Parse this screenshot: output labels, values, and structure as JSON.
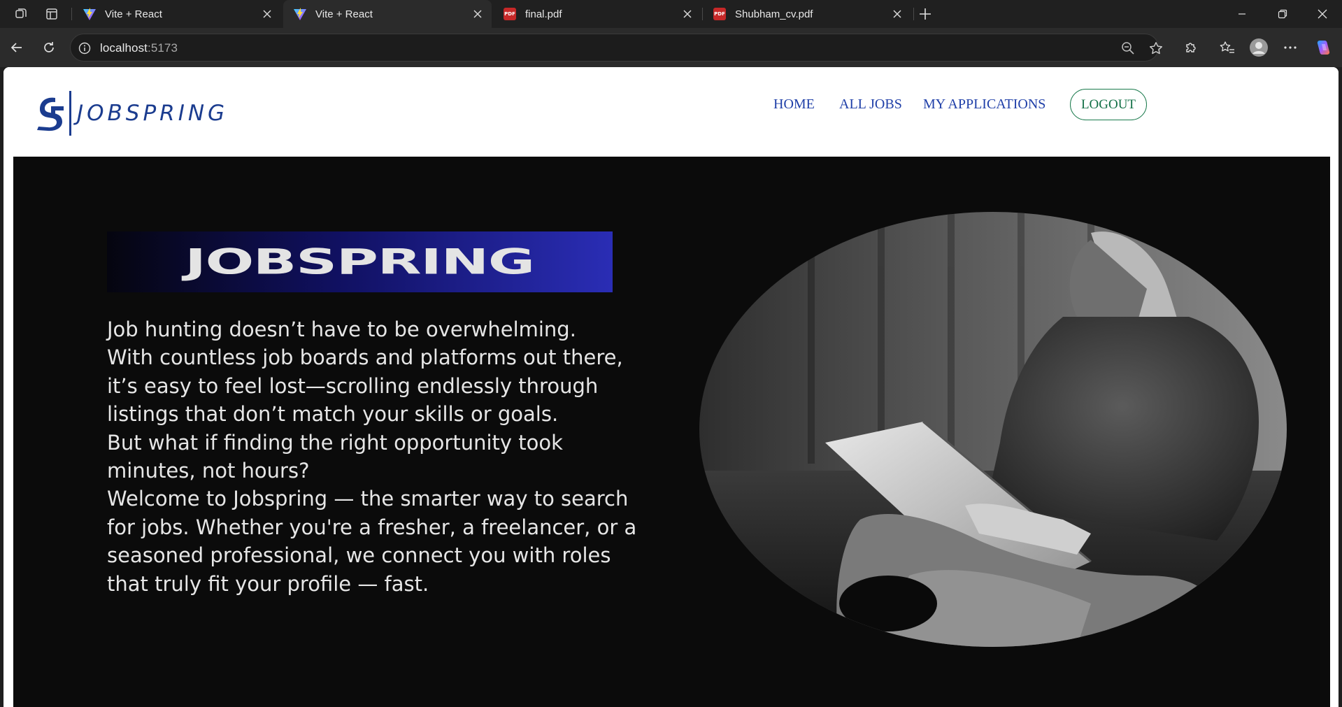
{
  "browser": {
    "tabs": [
      {
        "title": "Vite + React",
        "favicon": "vite-icon",
        "active": false
      },
      {
        "title": "Vite + React",
        "favicon": "vite-icon",
        "active": true
      },
      {
        "title": "final.pdf",
        "favicon": "pdf-icon",
        "active": false
      },
      {
        "title": "Shubham_cv.pdf",
        "favicon": "pdf-icon",
        "active": false
      }
    ],
    "pdf_badge": "PDF",
    "address": {
      "host": "localhost",
      "port": ":5173"
    }
  },
  "site": {
    "logo_text": "JOBSPRING",
    "nav": {
      "home": "HOME",
      "all_jobs": "ALL JOBS",
      "my_applications": "MY APPLICATIONS",
      "logout": "LOGOUT"
    },
    "colors": {
      "nav": "#1f3fa8",
      "logout": "#127046",
      "hero_bg": "#0b0b0b"
    }
  },
  "hero": {
    "banner": "JOBSPRING",
    "paragraph1": "Job hunting doesn’t have to be overwhelming.\nWith countless job boards and platforms out there,\nit’s easy to feel lost—scrolling endlessly through\nlistings that don’t match your skills or goals.",
    "paragraph2": "But what if finding the right opportunity took\nminutes, not hours?",
    "paragraph3": "Welcome to Jobspring — the smarter way to search\nfor jobs. Whether you're a fresher, a freelancer, or a\nseasoned professional, we connect you with roles\nthat truly fit your profile — fast."
  }
}
